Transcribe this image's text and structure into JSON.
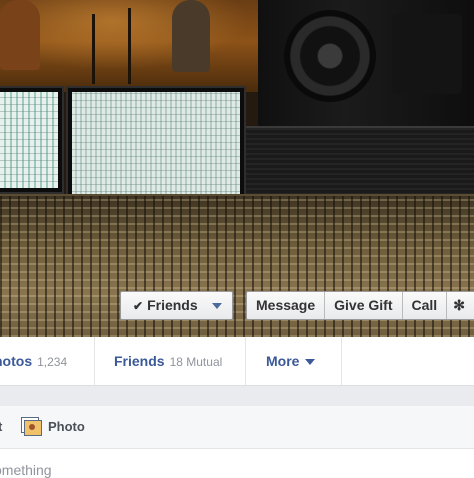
{
  "actions": {
    "friends_label": "Friends",
    "message_label": "Message",
    "gift_label": "Give Gift",
    "call_label": "Call"
  },
  "tabs": [
    {
      "label": "hotos",
      "count": "1,234"
    },
    {
      "label": "Friends",
      "count": "18 Mutual"
    },
    {
      "label": "More",
      "count": ""
    }
  ],
  "composer": {
    "status_label": "t",
    "photo_label": "Photo",
    "placeholder": "omething"
  },
  "icons": {
    "check": "check-icon",
    "caret": "caret-down-icon",
    "gear": "gear-icon",
    "photo": "photo-icon"
  },
  "colors": {
    "link": "#3b5998",
    "count": "#90949c",
    "button_bg": "#f6f7f9"
  }
}
